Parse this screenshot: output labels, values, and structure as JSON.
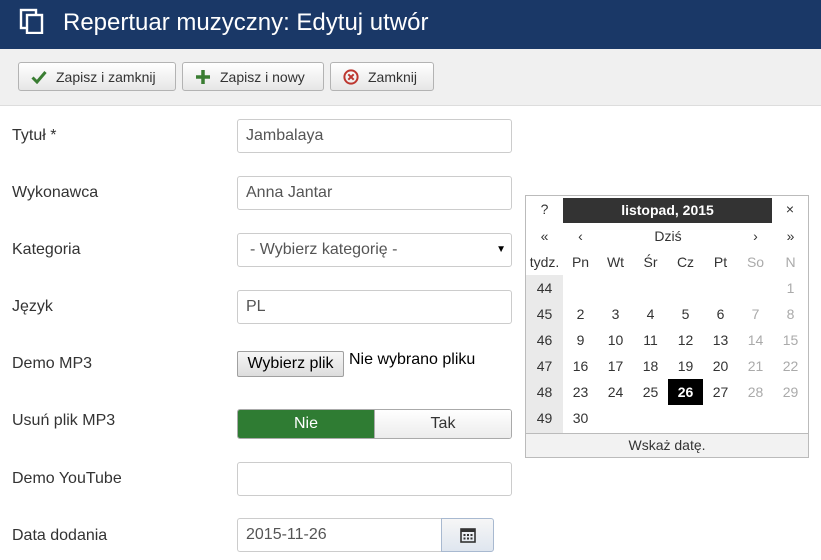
{
  "header": {
    "title": "Repertuar muzyczny: Edytuj utwór",
    "icon": "copy-icon"
  },
  "toolbar": {
    "save_close": "Zapisz i zamknij",
    "save_new": "Zapisz i nowy",
    "close": "Zamknij",
    "colors": {
      "check": "#3a7d32",
      "plus": "#3a7d32",
      "close": "#bd362f"
    }
  },
  "form": {
    "title_label": "Tytuł *",
    "title_value": "Jambalaya",
    "artist_label": "Wykonawca",
    "artist_value": "Anna Jantar",
    "category_label": "Kategoria",
    "category_value": "- Wybierz kategorię -",
    "language_label": "Język",
    "language_value": "PL",
    "demo_mp3_label": "Demo MP3",
    "file_button": "Wybierz plik",
    "file_status": "Nie wybrano pliku",
    "delete_mp3_label": "Usuń plik MP3",
    "toggle_no": "Nie",
    "toggle_yes": "Tak",
    "demo_youtube_label": "Demo YouTube",
    "demo_youtube_value": "",
    "date_label": "Data dodania",
    "date_value": "2015-11-26"
  },
  "calendar": {
    "help": "?",
    "title": "listopad, 2015",
    "close": "×",
    "prev_year": "«",
    "prev_month": "‹",
    "today": "Dziś",
    "next_month": "›",
    "next_year": "»",
    "weekday_headers": [
      "tydz.",
      "Pn",
      "Wt",
      "Śr",
      "Cz",
      "Pt",
      "So",
      "N"
    ],
    "weeks": [
      {
        "num": "44",
        "days": [
          "",
          "",
          "",
          "",
          "",
          "",
          "1"
        ]
      },
      {
        "num": "45",
        "days": [
          "2",
          "3",
          "4",
          "5",
          "6",
          "7",
          "8"
        ]
      },
      {
        "num": "46",
        "days": [
          "9",
          "10",
          "11",
          "12",
          "13",
          "14",
          "15"
        ]
      },
      {
        "num": "47",
        "days": [
          "16",
          "17",
          "18",
          "19",
          "20",
          "21",
          "22"
        ]
      },
      {
        "num": "48",
        "days": [
          "23",
          "24",
          "25",
          "26",
          "27",
          "28",
          "29"
        ]
      },
      {
        "num": "49",
        "days": [
          "30",
          "",
          "",
          "",
          "",
          "",
          ""
        ]
      }
    ],
    "selected_day": "26",
    "footer": "Wskaż datę."
  }
}
